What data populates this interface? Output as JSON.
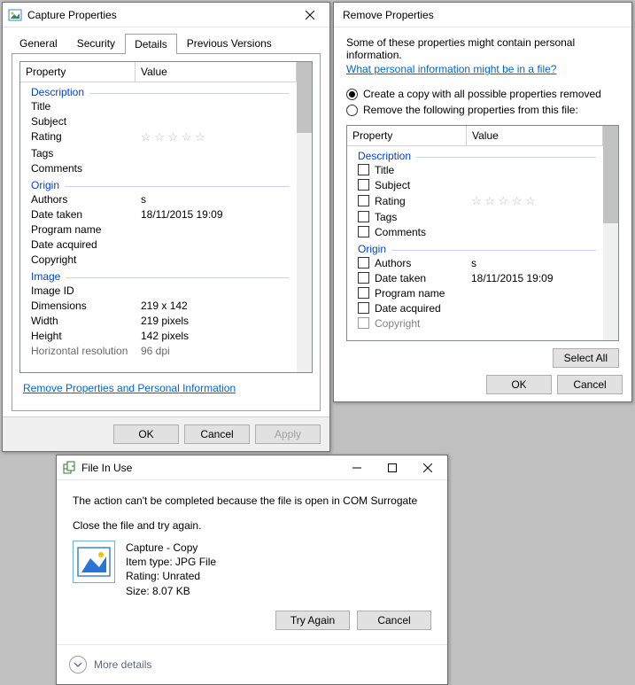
{
  "win1": {
    "title": "Capture Properties",
    "tabs": [
      "General",
      "Security",
      "Details",
      "Previous Versions"
    ],
    "cols": {
      "prop": "Property",
      "value": "Value"
    },
    "groups": {
      "description": "Description",
      "origin": "Origin",
      "image": "Image"
    },
    "rows": {
      "title": "Title",
      "subject": "Subject",
      "rating": "Rating",
      "tags": "Tags",
      "comments": "Comments",
      "authors": "Authors",
      "authors_val": "s",
      "date_taken": "Date taken",
      "date_taken_val": "18/11/2015 19:09",
      "program_name": "Program name",
      "date_acquired": "Date acquired",
      "copyright": "Copyright",
      "image_id": "Image ID",
      "dimensions": "Dimensions",
      "dimensions_val": "219 x 142",
      "width": "Width",
      "width_val": "219 pixels",
      "height": "Height",
      "height_val": "142 pixels",
      "hres": "Horizontal resolution",
      "hres_val": "96 dpi"
    },
    "link": "Remove Properties and Personal Information",
    "buttons": {
      "ok": "OK",
      "cancel": "Cancel",
      "apply": "Apply"
    }
  },
  "win2": {
    "title": "Remove Properties",
    "intro": "Some of these properties might contain personal information.",
    "link": "What personal information might be in a file?",
    "radio1": "Create a copy with all possible properties removed",
    "radio2": "Remove the following properties from this file:",
    "cols": {
      "prop": "Property",
      "value": "Value"
    },
    "groups": {
      "description": "Description",
      "origin": "Origin"
    },
    "rows": {
      "title": "Title",
      "subject": "Subject",
      "rating": "Rating",
      "tags": "Tags",
      "comments": "Comments",
      "authors": "Authors",
      "authors_val": "s",
      "date_taken": "Date taken",
      "date_taken_val": "18/11/2015 19:09",
      "program_name": "Program name",
      "date_acquired": "Date acquired",
      "copyright": "Copyright"
    },
    "buttons": {
      "select_all": "Select All",
      "ok": "OK",
      "cancel": "Cancel"
    }
  },
  "win3": {
    "title": "File In Use",
    "line1": "The action can't be completed because the file is open in COM Surrogate",
    "line2": "Close the file and try again.",
    "file": {
      "name": "Capture - Copy",
      "type": "Item type: JPG File",
      "rating": "Rating: Unrated",
      "size": "Size: 8.07 KB"
    },
    "buttons": {
      "try_again": "Try Again",
      "cancel": "Cancel"
    },
    "more": "More details"
  }
}
